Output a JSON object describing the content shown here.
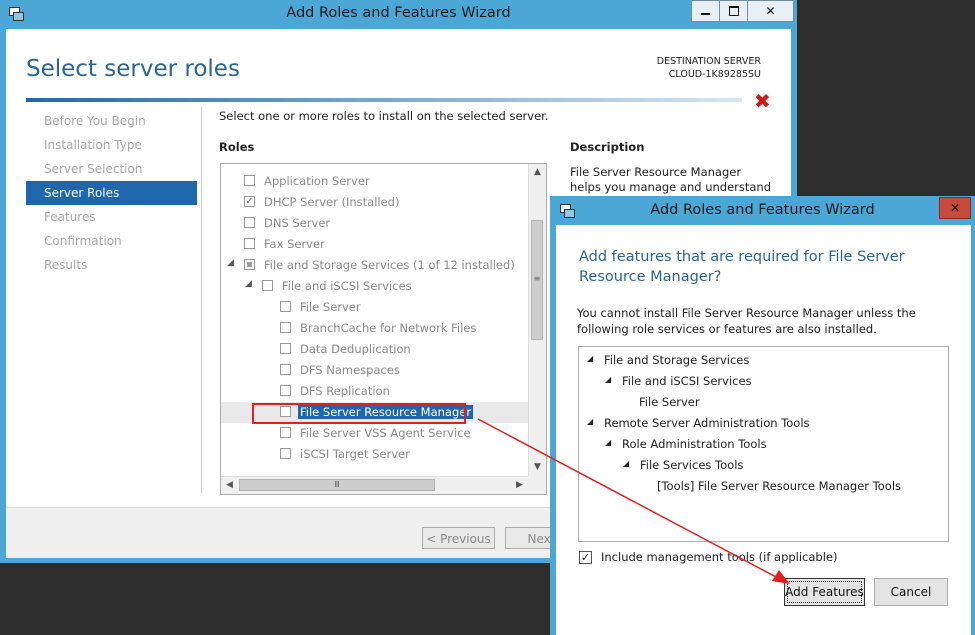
{
  "main_window": {
    "title": "Add Roles and Features Wizard",
    "page_title": "Select server roles",
    "destination_label": "DESTINATION SERVER",
    "destination_name": "CLOUD-1K89285SU",
    "nav": [
      {
        "label": "Before You Begin",
        "active": false
      },
      {
        "label": "Installation Type",
        "active": false
      },
      {
        "label": "Server Selection",
        "active": false
      },
      {
        "label": "Server Roles",
        "active": true
      },
      {
        "label": "Features",
        "active": false
      },
      {
        "label": "Confirmation",
        "active": false
      },
      {
        "label": "Results",
        "active": false
      }
    ],
    "instructions": "Select one or more roles to install on the selected server.",
    "roles_heading": "Roles",
    "description_heading": "Description",
    "description_text": "File Server Resource Manager helps you manage and understand the",
    "roles": [
      {
        "label": "Application Server",
        "level": 0,
        "state": "unchecked"
      },
      {
        "label": "DHCP Server (Installed)",
        "level": 0,
        "state": "checked"
      },
      {
        "label": "DNS Server",
        "level": 0,
        "state": "unchecked"
      },
      {
        "label": "Fax Server",
        "level": 0,
        "state": "unchecked"
      },
      {
        "label": "File and Storage Services (1 of 12 installed)",
        "level": 0,
        "state": "partial",
        "expander": "◢"
      },
      {
        "label": "File and iSCSI Services",
        "level": 1,
        "state": "unchecked",
        "expander": "◢"
      },
      {
        "label": "File Server",
        "level": 2,
        "state": "unchecked"
      },
      {
        "label": "BranchCache for Network Files",
        "level": 2,
        "state": "unchecked"
      },
      {
        "label": "Data Deduplication",
        "level": 2,
        "state": "unchecked"
      },
      {
        "label": "DFS Namespaces",
        "level": 2,
        "state": "unchecked"
      },
      {
        "label": "DFS Replication",
        "level": 2,
        "state": "unchecked"
      },
      {
        "label": "File Server Resource Manager",
        "level": 2,
        "state": "unchecked",
        "selected": true
      },
      {
        "label": "File Server VSS Agent Service",
        "level": 2,
        "state": "unchecked"
      },
      {
        "label": "iSCSI Target Server",
        "level": 2,
        "state": "unchecked"
      }
    ],
    "previous_label": "< Previous",
    "next_label": "Next"
  },
  "dialog": {
    "title": "Add Roles and Features Wizard",
    "heading": "Add features that are required for File Server Resource Manager?",
    "message": "You cannot install File Server Resource Manager unless the following role services or features are also installed.",
    "tree": [
      {
        "label": "File and Storage Services",
        "level": 0,
        "expander": "◢"
      },
      {
        "label": "File and iSCSI Services",
        "level": 1,
        "expander": "◢"
      },
      {
        "label": "File Server",
        "level": 2
      },
      {
        "label": "Remote Server Administration Tools",
        "level": 0,
        "expander": "◢"
      },
      {
        "label": "Role Administration Tools",
        "level": 1,
        "expander": "◢"
      },
      {
        "label": "File Services Tools",
        "level": 2,
        "expander": "◢"
      },
      {
        "label": "[Tools] File Server Resource Manager Tools",
        "level": 3
      }
    ],
    "include_mgmt_label": "Include management tools (if applicable)",
    "include_mgmt_checked": true,
    "add_features_label": "Add Features",
    "cancel_label": "Cancel"
  },
  "colors": {
    "accent_blue": "#1f67ad",
    "title_blue": "#2c6592",
    "highlight_red": "#e02121",
    "window_frame": "#4aa7d6"
  },
  "icons": {
    "expander": "◢",
    "check": "✓",
    "close": "✕",
    "error_x": "✖",
    "scroll_up": "▲",
    "scroll_down": "▼",
    "scroll_left": "◀",
    "scroll_right": "▶",
    "grip_v": "≡",
    "grip_h": "Ⅲ"
  }
}
